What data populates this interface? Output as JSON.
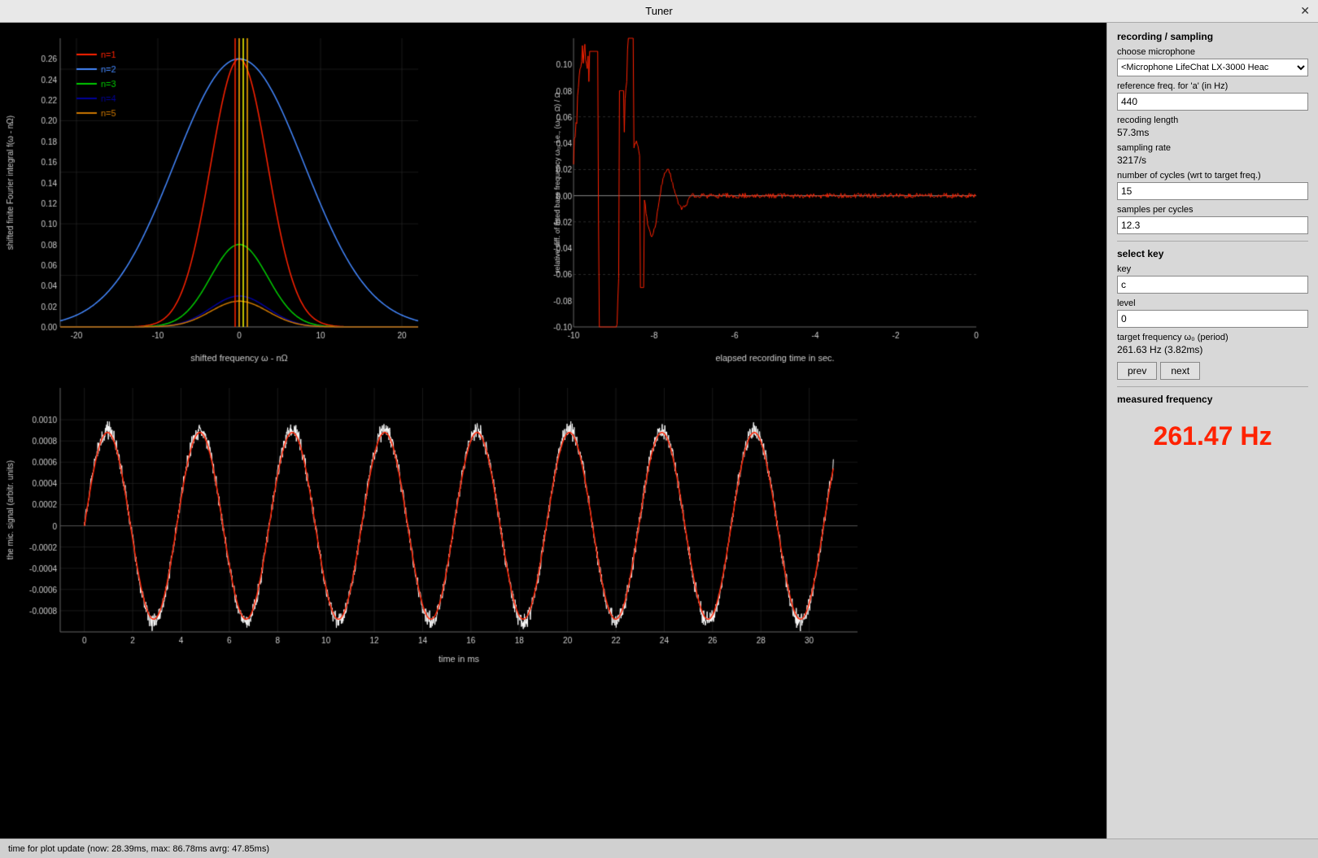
{
  "window": {
    "title": "Tuner",
    "close_label": "✕"
  },
  "right_panel": {
    "recording_section_title": "recording / sampling",
    "microphone_label": "choose microphone",
    "microphone_value": "<Microphone LifeChat LX-3000 Heac",
    "ref_freq_label": "reference freq. for 'a' (in Hz)",
    "ref_freq_value": "440",
    "recording_length_label": "recoding length",
    "recording_length_value": "57.3ms",
    "sampling_rate_label": "sampling rate",
    "sampling_rate_value": "3217/s",
    "num_cycles_label": "number of cycles (wrt to target freq.)",
    "num_cycles_value": "15",
    "samples_per_cycle_label": "samples per cycles",
    "samples_per_cycle_value": "12.3",
    "select_key_title": "select key",
    "key_label": "key",
    "key_value": "c",
    "level_label": "level",
    "level_value": "0",
    "target_freq_label": "target frequency ω₀ (period)",
    "target_freq_value": "261.63 Hz (3.82ms)",
    "prev_button": "prev",
    "next_button": "next",
    "measured_freq_label": "measured frequency",
    "measured_freq_value": "261.47 Hz"
  },
  "status_bar": {
    "text": "time for plot update (now: 28.39ms, max: 86.78ms avrg: 47.85ms)"
  },
  "plots": {
    "fourier_y_label": "shifted finite Fourier integral f(ω - nΩ)",
    "fourier_x_label": "shifted frequency ω - nΩ",
    "fourier_x_ticks": [
      "-20",
      "-10",
      "0",
      "10",
      "20"
    ],
    "fourier_y_ticks": [
      "0",
      "0.02",
      "0.04",
      "0.06",
      "0.08",
      "0.10",
      "0.12",
      "0.14",
      "0.16",
      "0.18",
      "0.20",
      "0.22",
      "0.24",
      "0.26"
    ],
    "fourier_legend": [
      {
        "label": "n=1",
        "color": "#ff0000"
      },
      {
        "label": "n=2",
        "color": "#4488ff"
      },
      {
        "label": "n=3",
        "color": "#00cc00"
      },
      {
        "label": "n=4",
        "color": "#000080"
      },
      {
        "label": "n=5",
        "color": "#cc8800"
      }
    ],
    "diff_y_label": "relative diff. of fitted base frequency ω₀, i.e., (ω₁ - Ω) / Ω",
    "diff_x_label": "elapsed recording time in sec.",
    "diff_x_ticks": [
      "-10",
      "-8",
      "-6",
      "-4",
      "-2",
      "0"
    ],
    "diff_y_ticks": [
      "-0.1",
      "-0.08",
      "-0.06",
      "-0.04",
      "-0.02",
      "0",
      "0.02",
      "0.04",
      "0.06",
      "0.08",
      "0.1"
    ],
    "mic_y_label": "the mic. signal (arbitr. units)",
    "mic_x_label": "time in ms",
    "mic_x_ticks": [
      "0",
      "2",
      "4",
      "6",
      "8",
      "10",
      "12",
      "14",
      "16",
      "18",
      "20",
      "22",
      "24",
      "26",
      "28",
      "30"
    ],
    "mic_y_ticks": [
      "-0.0008",
      "-0.0006",
      "-0.0004",
      "-0.0002",
      "0",
      "0.0002",
      "0.0004",
      "0.0006",
      "0.0008",
      "0.001"
    ]
  }
}
